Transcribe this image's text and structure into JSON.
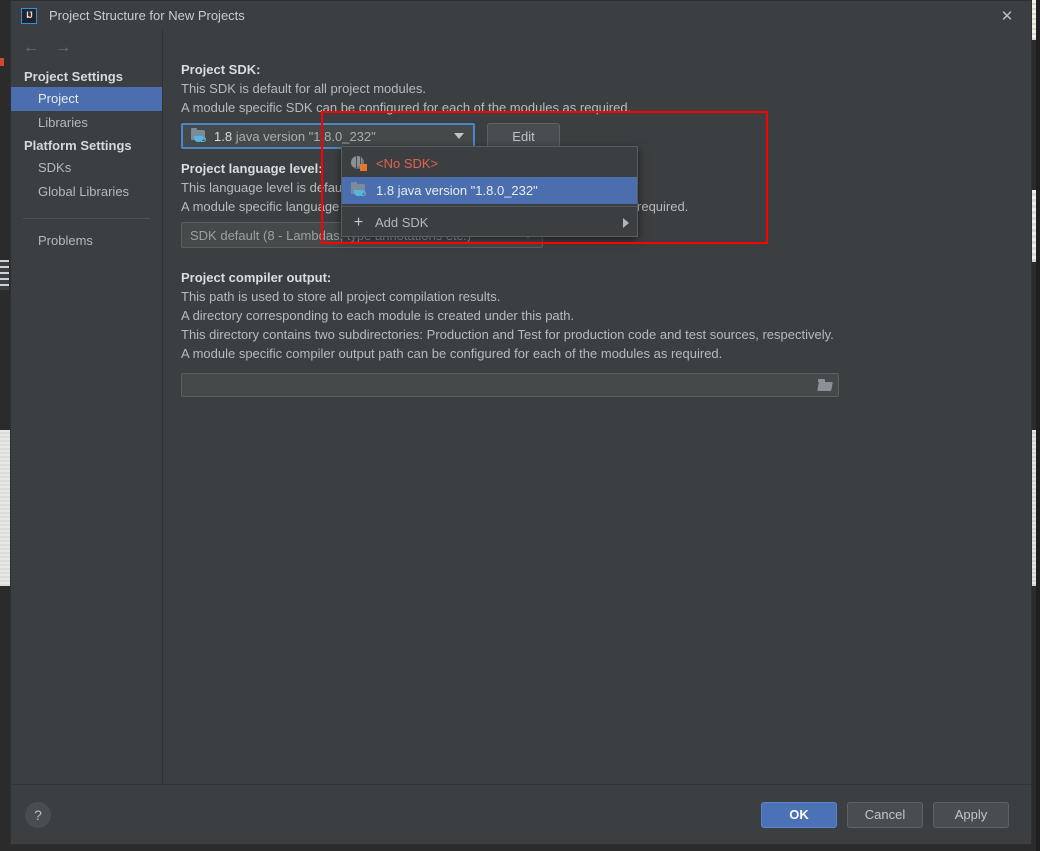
{
  "window": {
    "title": "Project Structure for New Projects",
    "logo_text": "IJ",
    "logo_icon": "intellij-idea-icon",
    "close_icon": "close-icon"
  },
  "sidebar": {
    "back_icon": "arrow-left-icon",
    "forward_icon": "arrow-right-icon",
    "groups": [
      {
        "title": "Project Settings",
        "items": [
          {
            "label": "Project",
            "selected": true
          },
          {
            "label": "Libraries",
            "selected": false
          }
        ]
      },
      {
        "title": "Platform Settings",
        "items": [
          {
            "label": "SDKs",
            "selected": false
          },
          {
            "label": "Global Libraries",
            "selected": false
          }
        ]
      }
    ],
    "problems_label": "Problems"
  },
  "main": {
    "project_sdk": {
      "heading": "Project SDK:",
      "desc_line1": "This SDK is default for all project modules.",
      "desc_line2": "A module specific SDK can be configured for each of the modules as required.",
      "combo_icon": "java-sdk-icon",
      "combo_value_version": "1.8",
      "combo_value_rest": "java version \"1.8.0_232\"",
      "combo_caret_icon": "chevron-down-icon",
      "edit_button_label": "Edit"
    },
    "project_language_level": {
      "heading": "Project language level:",
      "desc_line1": "This language level is default for all project modules.",
      "desc_line2": "A module specific language level can be configured for each of the modules as required.",
      "combo_value": "SDK default (8 - Lambdas, type annotations etc.)",
      "combo_caret_icon": "chevron-down-icon"
    },
    "project_compiler_output": {
      "heading": "Project compiler output:",
      "desc_line1": "This path is used to store all project compilation results.",
      "desc_line2": "A directory corresponding to each module is created under this path.",
      "desc_line3": "This directory contains two subdirectories: Production and Test for production code and test sources, respectively.",
      "desc_line4": "A module specific compiler output path can be configured for each of the modules as required.",
      "path_value": "",
      "path_placeholder": "",
      "browse_icon": "folder-open-icon"
    }
  },
  "sdk_popup": {
    "items": [
      {
        "label": "<No SDK>",
        "icon": "no-sdk-globe-icon",
        "state": "none",
        "highlighted": false
      },
      {
        "label": "1.8 java version \"1.8.0_232\"",
        "icon": "java-sdk-icon",
        "state": "normal",
        "highlighted": true
      },
      {
        "label": "Add SDK",
        "icon": "plus-icon",
        "state": "submenu",
        "highlighted": false,
        "submenu_arrow_icon": "chevron-right-icon"
      }
    ]
  },
  "footer": {
    "help_label": "?",
    "help_icon": "help-icon",
    "ok_label": "OK",
    "cancel_label": "Cancel",
    "apply_label": "Apply"
  },
  "annotation": {
    "highlight_color": "#ff0000"
  },
  "colors": {
    "dialog_bg": "#3c3f41",
    "selection_blue": "#4b6eaf",
    "primary_button": "#4b72b4",
    "focus_border": "#4b87c7",
    "error_red": "#e2604f",
    "annotation_red": "#ff0000"
  }
}
